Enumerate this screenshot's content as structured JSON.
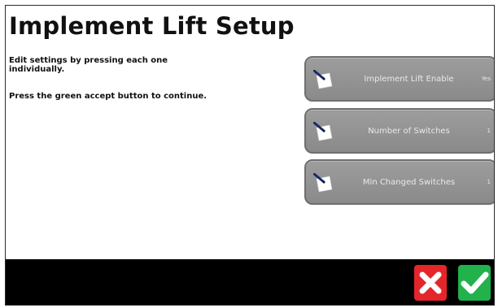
{
  "screen": {
    "title": "Implement Lift Setup",
    "instructions": [
      "Edit settings by pressing each one individually.",
      "Press the green accept button to continue."
    ]
  },
  "settings": [
    {
      "label": "Implement Lift Enable",
      "value": "Yes",
      "icon": "edit-note-icon"
    },
    {
      "label": "Number of Switches",
      "value": "1",
      "icon": "edit-note-icon"
    },
    {
      "label": "Min Changed Switches",
      "value": "1",
      "icon": "edit-note-icon"
    }
  ],
  "actions": {
    "cancel_icon": "close-x-icon",
    "accept_icon": "checkmark-icon"
  },
  "colors": {
    "cancel": "#e4262a",
    "accept": "#21b24b",
    "setting_button": "#949494",
    "bottom_bar": "#000000"
  }
}
